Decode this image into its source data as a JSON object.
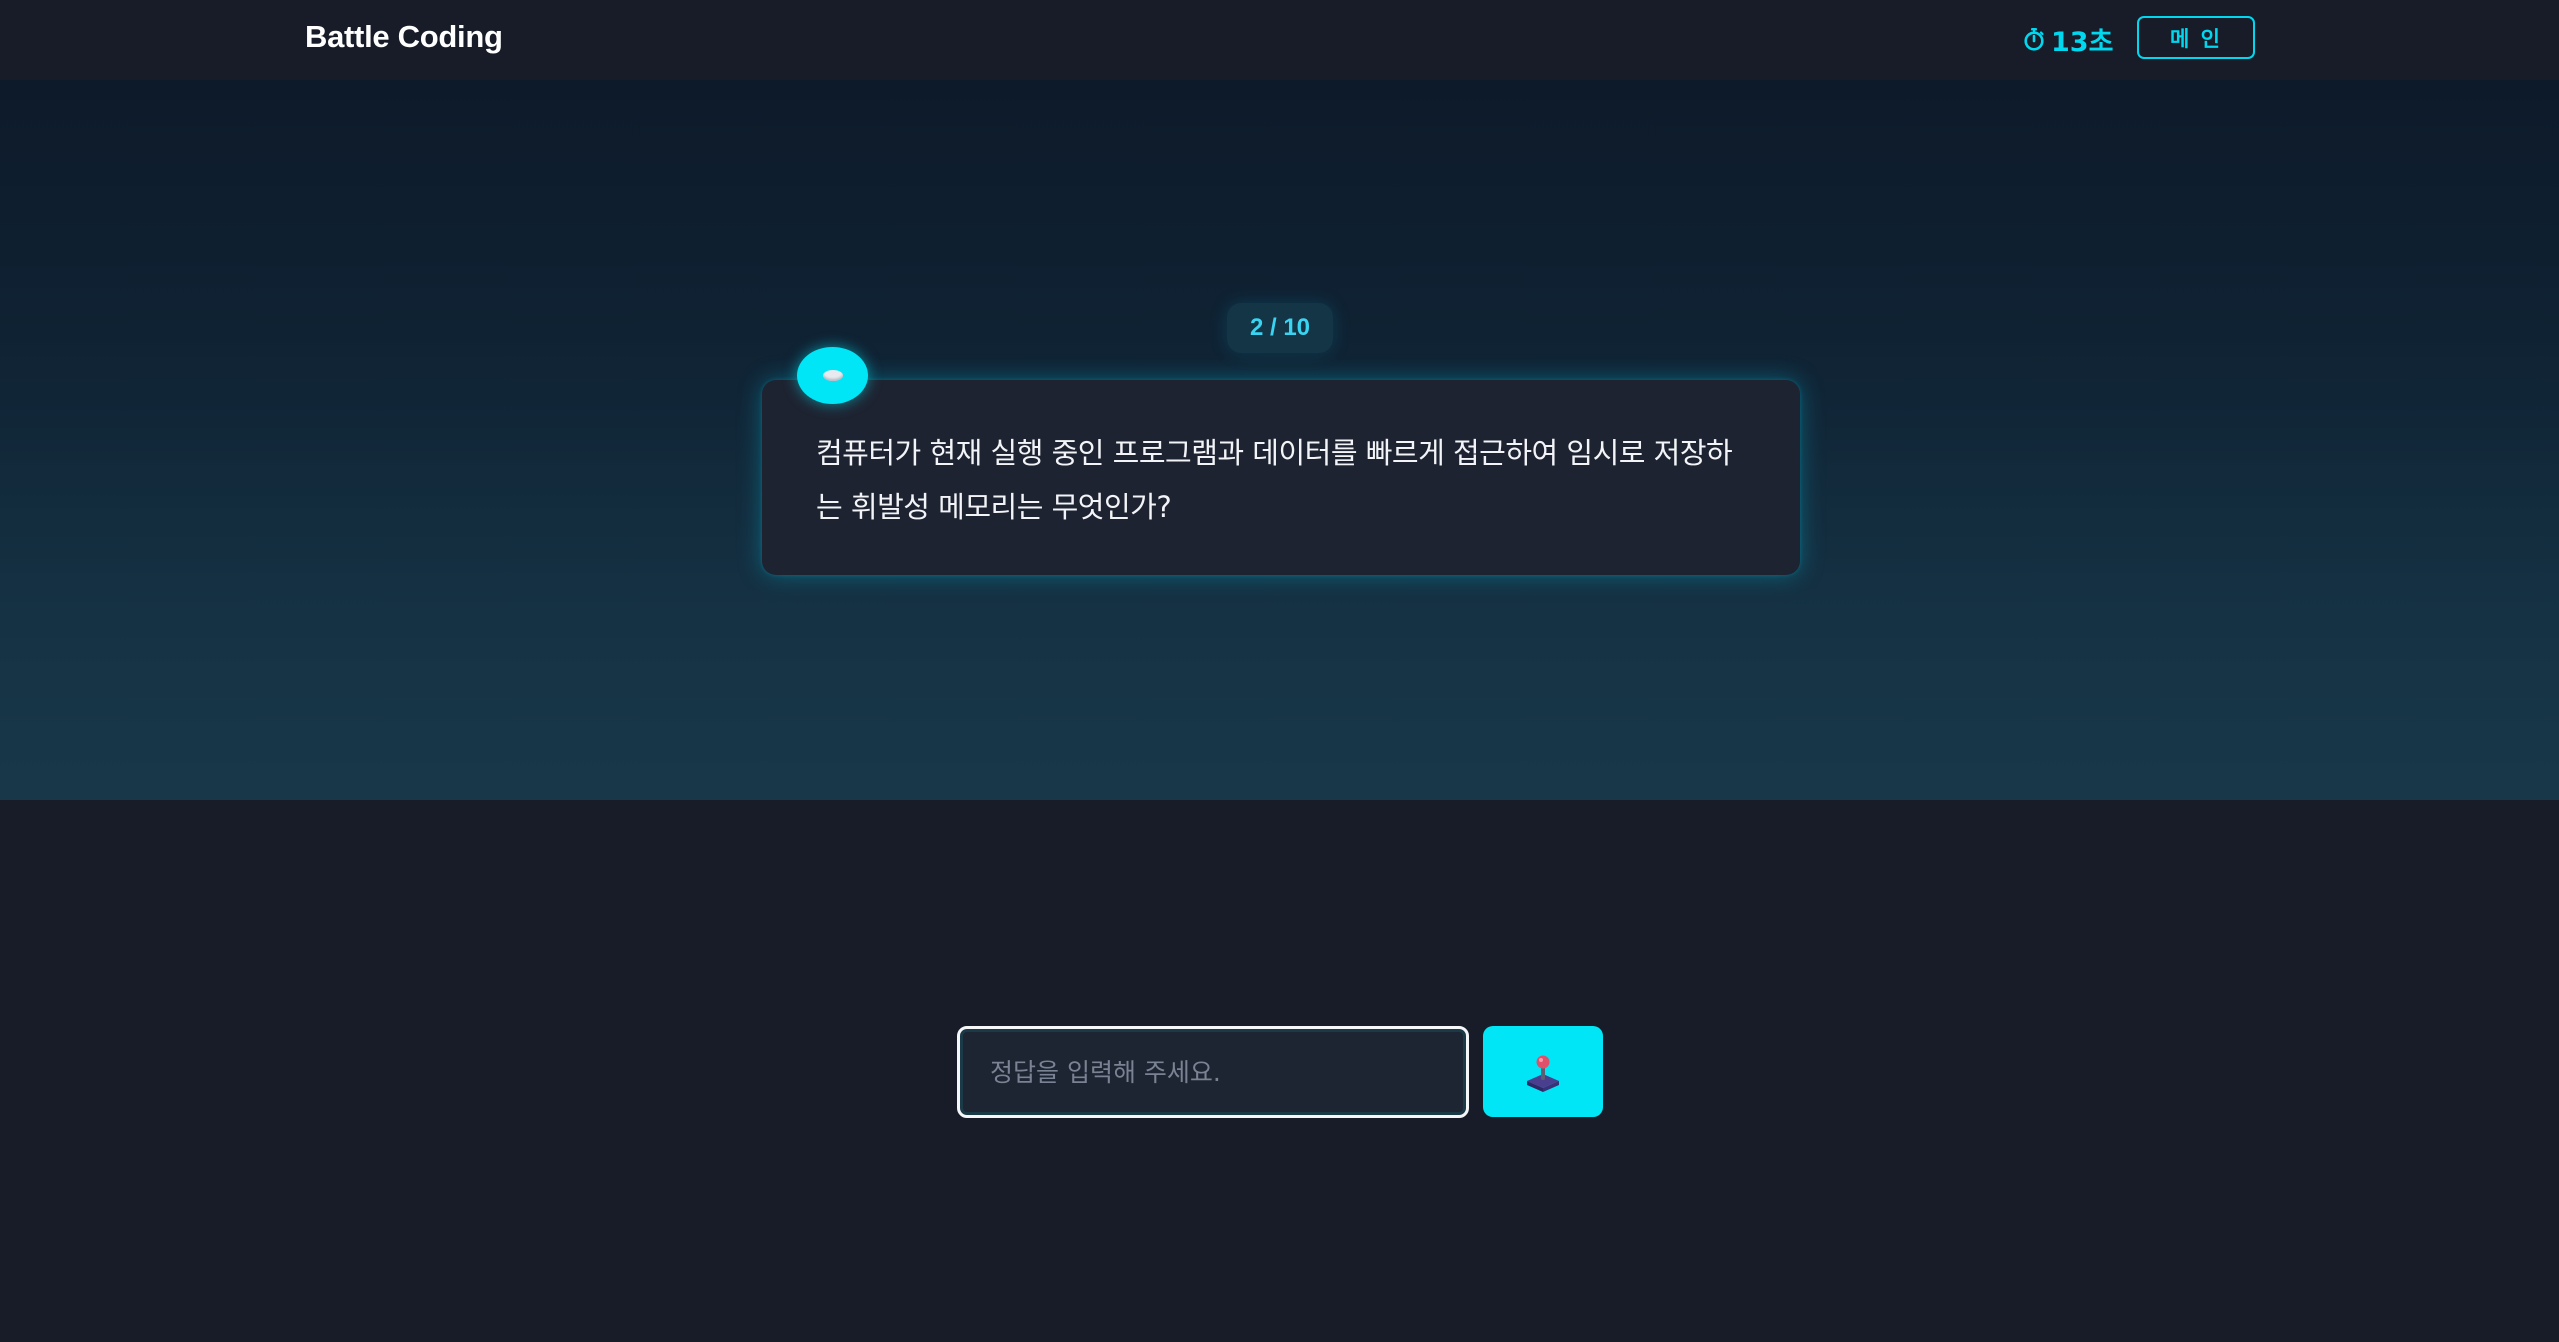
{
  "header": {
    "brand": "Battle Coding",
    "timer_icon": "stopwatch-icon",
    "timer_text": "13초",
    "main_button_label": "메 인"
  },
  "quiz": {
    "progress": "2 / 10",
    "question_icon": "speech-bubble-icon",
    "question": "컴퓨터가 현재 실행 중인 프로그램과 데이터를 빠르게 접근하여 임시로 저장하는 휘발성 메모리는 무엇인가?"
  },
  "answer": {
    "placeholder": "정답을 입력해 주세요.",
    "value": "",
    "submit_icon": "joystick-icon"
  },
  "colors": {
    "accent": "#00e6f6",
    "background": "#171c28",
    "card": "#1e2331"
  }
}
